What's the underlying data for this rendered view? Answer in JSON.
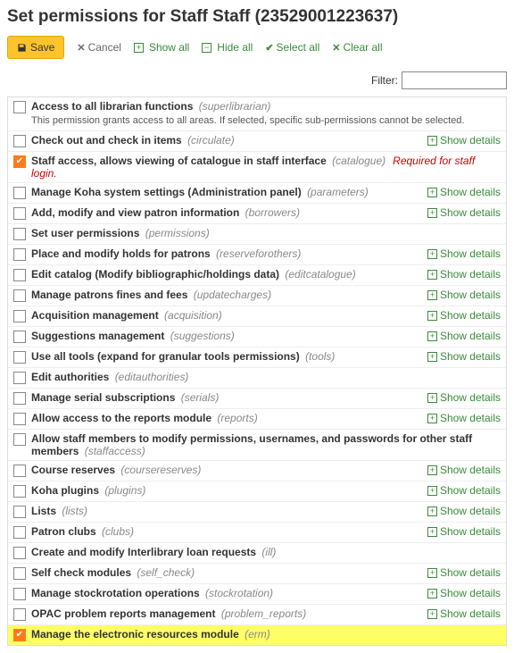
{
  "page_title": "Set permissions for Staff Staff (23529001223637)",
  "toolbar": {
    "save": "Save",
    "cancel": "Cancel",
    "show_all": "Show all",
    "hide_all": "Hide all",
    "select_all": "Select all",
    "clear_all": "Clear all",
    "filter_label": "Filter:"
  },
  "show_details": "Show details",
  "permissions": [
    {
      "label": "Access to all librarian functions",
      "code": "(superlibrarian)",
      "checked": false,
      "details": false,
      "note": "This permission grants access to all areas. If selected, specific sub-permissions cannot be selected."
    },
    {
      "label": "Check out and check in items",
      "code": "(circulate)",
      "checked": false,
      "details": true
    },
    {
      "label": "Staff access, allows viewing of catalogue in staff interface",
      "code": "(catalogue)",
      "checked": true,
      "details": false,
      "required": "Required for staff login."
    },
    {
      "label": "Manage Koha system settings (Administration panel)",
      "code": "(parameters)",
      "checked": false,
      "details": true
    },
    {
      "label": "Add, modify and view patron information",
      "code": "(borrowers)",
      "checked": false,
      "details": true
    },
    {
      "label": "Set user permissions",
      "code": "(permissions)",
      "checked": false,
      "details": false
    },
    {
      "label": "Place and modify holds for patrons",
      "code": "(reserveforothers)",
      "checked": false,
      "details": true
    },
    {
      "label": "Edit catalog (Modify bibliographic/holdings data)",
      "code": "(editcatalogue)",
      "checked": false,
      "details": true
    },
    {
      "label": "Manage patrons fines and fees",
      "code": "(updatecharges)",
      "checked": false,
      "details": true
    },
    {
      "label": "Acquisition management",
      "code": "(acquisition)",
      "checked": false,
      "details": true
    },
    {
      "label": "Suggestions management",
      "code": "(suggestions)",
      "checked": false,
      "details": true
    },
    {
      "label": "Use all tools (expand for granular tools permissions)",
      "code": "(tools)",
      "checked": false,
      "details": true
    },
    {
      "label": "Edit authorities",
      "code": "(editauthorities)",
      "checked": false,
      "details": false
    },
    {
      "label": "Manage serial subscriptions",
      "code": "(serials)",
      "checked": false,
      "details": true
    },
    {
      "label": "Allow access to the reports module",
      "code": "(reports)",
      "checked": false,
      "details": true
    },
    {
      "label": "Allow staff members to modify permissions, usernames, and passwords for other staff members",
      "code": "(staffaccess)",
      "checked": false,
      "details": false
    },
    {
      "label": "Course reserves",
      "code": "(coursereserves)",
      "checked": false,
      "details": true
    },
    {
      "label": "Koha plugins",
      "code": "(plugins)",
      "checked": false,
      "details": true
    },
    {
      "label": "Lists",
      "code": "(lists)",
      "checked": false,
      "details": true
    },
    {
      "label": "Patron clubs",
      "code": "(clubs)",
      "checked": false,
      "details": true
    },
    {
      "label": "Create and modify Interlibrary loan requests",
      "code": "(ill)",
      "checked": false,
      "details": false
    },
    {
      "label": "Self check modules",
      "code": "(self_check)",
      "checked": false,
      "details": true
    },
    {
      "label": "Manage stockrotation operations",
      "code": "(stockrotation)",
      "checked": false,
      "details": true
    },
    {
      "label": "OPAC problem reports management",
      "code": "(problem_reports)",
      "checked": false,
      "details": true
    },
    {
      "label": "Manage the electronic resources module",
      "code": "(erm)",
      "checked": true,
      "details": false,
      "highlight": true
    }
  ]
}
